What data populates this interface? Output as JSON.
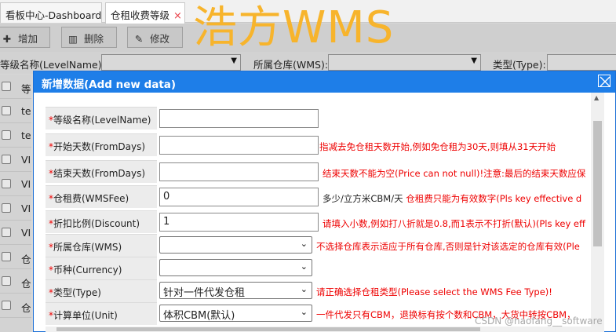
{
  "tabs": [
    {
      "label": "看板中心-Dashboard"
    },
    {
      "label": "仓租收费等级",
      "close": "×"
    }
  ],
  "watermark": "浩方WMS",
  "toolbar": {
    "add": "增加",
    "delete": "删除",
    "edit": "修改"
  },
  "filters": {
    "level_name_label": "等级名称(LevelName):",
    "warehouse_label": "所属仓库(WMS):",
    "type_label": "类型(Type):"
  },
  "grid_rows": [
    "等",
    "te",
    "te",
    "VI",
    "VI",
    "VI",
    "VI",
    "仓",
    "仓",
    "仓"
  ],
  "dialog": {
    "title": "新增数据(Add new data)",
    "fields": [
      {
        "required": "*",
        "label": "等级名称(LevelName)",
        "value": "",
        "hint": ""
      },
      {
        "required": "*",
        "label": "开始天数(FromDays)",
        "value": "",
        "hint": "指减去免仓租天数开始,例如免仓租为30天,则填从31天开始"
      },
      {
        "required": "*",
        "label": "结束天数(FromDays)",
        "value": "",
        "hint": "结束天数不能为空(Price can not null)!注意:最后的结束天数应保"
      },
      {
        "required": "*",
        "label": "仓租费(WMSFee)",
        "value": "0",
        "unit": "多少/立方米CBM/天",
        "hint": "仓租费只能为有效数字(Pls key effective d"
      },
      {
        "required": "*",
        "label": "折扣比例(Discount)",
        "value": "1",
        "hint": "请填入小数,例如打八折就是0.8,而1表示不打折(默认)(Pls key eff"
      },
      {
        "required": "*",
        "label": "所属仓库(WMS)",
        "value": "",
        "hint": "不选择仓库表示适应于所有仓库,否则是针对该选定的仓库有效(Ple"
      },
      {
        "required": "*",
        "label": "币种(Currency)",
        "value": "",
        "hint": ""
      },
      {
        "required": "*",
        "label": "类型(Type)",
        "value": "针对一件代发仓租",
        "hint": "请正确选择仓租类型(Please select the WMS Fee Type)!"
      },
      {
        "required": "*",
        "label": "计算单位(Unit)",
        "value": "体积CBM(默认)",
        "hint": "一件代发只有CBM，退换标有按个数和CBM，大货中转按CBM，"
      }
    ]
  },
  "footer_mark": "CSDN @haofang__software",
  "colors": {
    "accent": "#1e7ee8",
    "required": "#ee0000",
    "watermark": "#f7b42c"
  }
}
